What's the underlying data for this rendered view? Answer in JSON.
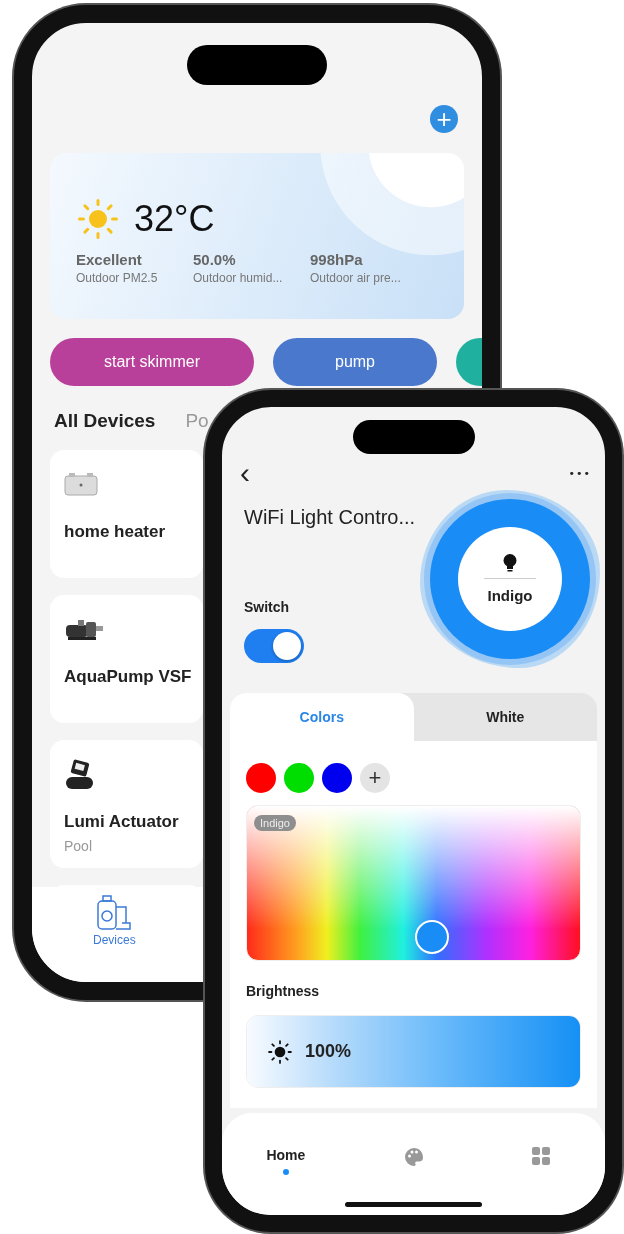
{
  "back_phone": {
    "add_button": "+",
    "weather": {
      "temperature": "32°C",
      "stats": [
        {
          "value": "Excellent",
          "label": "Outdoor PM2.5"
        },
        {
          "value": "50.0%",
          "label": "Outdoor humid..."
        },
        {
          "value": "998hPa",
          "label": "Outdoor air pre..."
        }
      ]
    },
    "scenes": [
      {
        "label": "start skimmer",
        "color": "#b8409a"
      },
      {
        "label": "pump",
        "color": "#4a78cc"
      },
      {
        "color": "#20b0a0"
      }
    ],
    "tabs": [
      {
        "label": "All Devices",
        "selected": true
      },
      {
        "label": "Po",
        "selected": false
      }
    ],
    "devices": [
      {
        "name": "home heater",
        "kind": "heater"
      },
      {
        "name": "AquaPump VSF",
        "kind": "pump"
      },
      {
        "name": "Lumi Actuator",
        "room": "Pool",
        "kind": "actuator"
      }
    ],
    "nav": [
      {
        "label": "Devices",
        "selected": true
      }
    ]
  },
  "front_phone": {
    "back": "‹",
    "more": "•••",
    "title": "WiFi Light Contro...",
    "switch": {
      "label": "Switch",
      "on": true
    },
    "dial": {
      "color_name": "Indigo"
    },
    "tabs": [
      {
        "label": "Colors",
        "selected": true
      },
      {
        "label": "White",
        "selected": false
      }
    ],
    "presets": [
      {
        "color": "#ff0000"
      },
      {
        "color": "#00dd00"
      },
      {
        "color": "#0000ee"
      }
    ],
    "add_preset": "+",
    "picker": {
      "badge": "Indigo"
    },
    "brightness": {
      "label": "Brightness",
      "level": 1,
      "reading": "100%"
    },
    "nav": [
      {
        "kind": "home",
        "label": "Home",
        "selected": true
      },
      {
        "kind": "palette",
        "selected": false
      },
      {
        "kind": "grid",
        "selected": false
      }
    ]
  }
}
